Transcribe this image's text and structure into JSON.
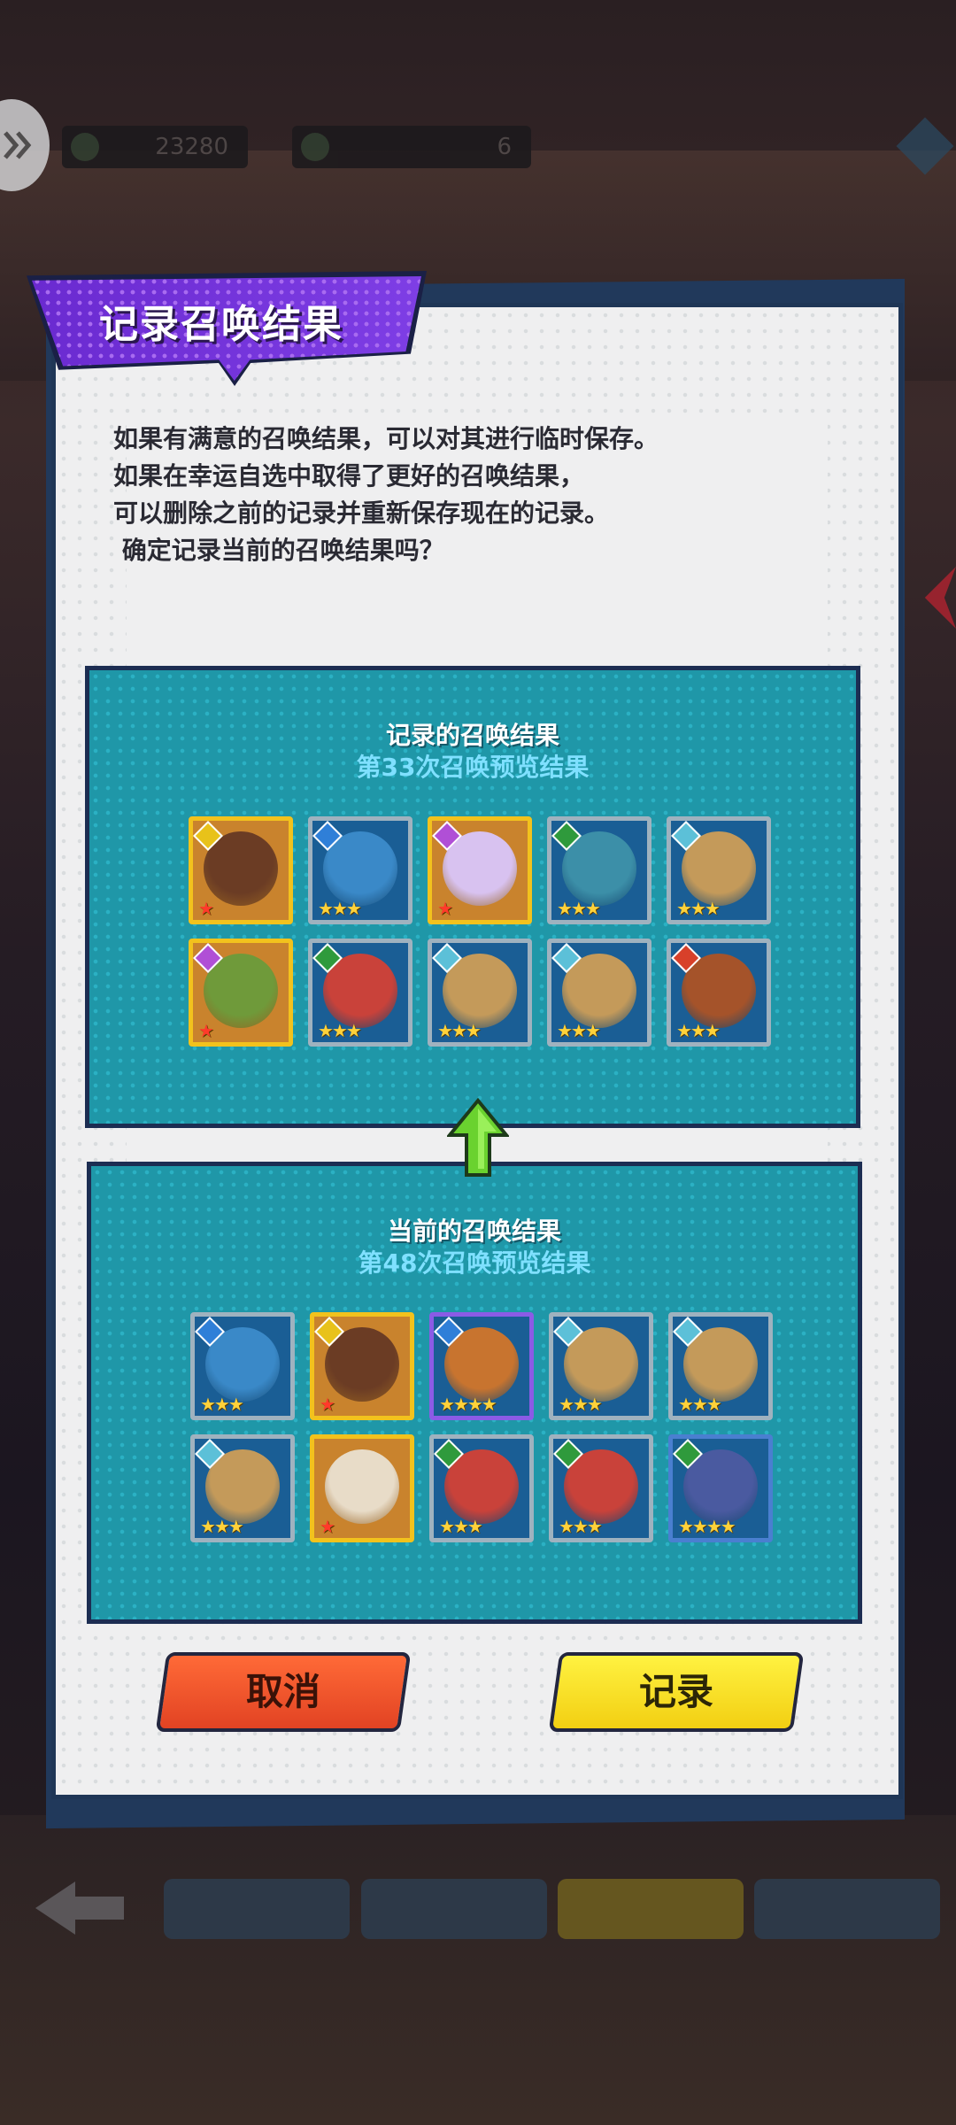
{
  "hud": {
    "currency_1": "23280",
    "currency_2": "6"
  },
  "dialog": {
    "title": "记录召唤结果",
    "description": [
      "如果有满意的召唤结果，可以对其进行临时保存。",
      "如果在幸运自选中取得了更好的召唤结果，",
      "可以删除之前的记录并重新保存现在的记录。",
      " 确定记录当前的召唤结果吗？"
    ],
    "saved_panel": {
      "title": "记录的召唤结果",
      "subtitle": "第33次召唤预览结果",
      "heroes": [
        {
          "frame": "gold",
          "element": "light-icon",
          "element_color": "#e8c21a",
          "stars": "★",
          "star_color": "red",
          "portrait_color": "#6b3c24"
        },
        {
          "frame": "silver",
          "element": "water-icon",
          "element_color": "#2f7fd8",
          "stars": "★★★",
          "star_color": "gold",
          "portrait_color": "#3a89c8"
        },
        {
          "frame": "gold",
          "element": "dark-icon",
          "element_color": "#b04fd6",
          "stars": "★",
          "star_color": "red",
          "portrait_color": "#d8c2f0"
        },
        {
          "frame": "silver",
          "element": "nature-icon",
          "element_color": "#2f9a3c",
          "stars": "★★★",
          "star_color": "gold",
          "portrait_color": "#3c8fa8"
        },
        {
          "frame": "silver",
          "element": "ice-icon",
          "element_color": "#5cc0d8",
          "stars": "★★★",
          "star_color": "gold",
          "portrait_color": "#c49a5a"
        },
        {
          "frame": "gold",
          "element": "dark-icon",
          "element_color": "#b04fd6",
          "stars": "★",
          "star_color": "red",
          "portrait_color": "#6f9a3a"
        },
        {
          "frame": "silver",
          "element": "nature-icon",
          "element_color": "#2f9a3c",
          "stars": "★★★",
          "star_color": "gold",
          "portrait_color": "#c9423a"
        },
        {
          "frame": "silver",
          "element": "ice-icon",
          "element_color": "#5cc0d8",
          "stars": "★★★",
          "star_color": "gold",
          "portrait_color": "#c49a5a"
        },
        {
          "frame": "silver",
          "element": "ice-icon",
          "element_color": "#5cc0d8",
          "stars": "★★★",
          "star_color": "gold",
          "portrait_color": "#c49a5a"
        },
        {
          "frame": "silver",
          "element": "fire-icon",
          "element_color": "#d8402a",
          "stars": "★★★",
          "star_color": "gold",
          "portrait_color": "#a5532a"
        }
      ]
    },
    "current_panel": {
      "title": "当前的召唤结果",
      "subtitle": "第48次召唤预览结果",
      "heroes": [
        {
          "frame": "silver",
          "element": "water-icon",
          "element_color": "#2f7fd8",
          "stars": "★★★",
          "star_color": "gold",
          "portrait_color": "#3a89c8"
        },
        {
          "frame": "gold",
          "element": "light-icon",
          "element_color": "#e8c21a",
          "stars": "★",
          "star_color": "red",
          "portrait_color": "#6b3c24"
        },
        {
          "frame": "purple",
          "element": "water-icon",
          "element_color": "#2f7fd8",
          "stars": "★★★★",
          "star_color": "gold",
          "portrait_color": "#c8742f"
        },
        {
          "frame": "silver",
          "element": "ice-icon",
          "element_color": "#5cc0d8",
          "stars": "★★★",
          "star_color": "gold",
          "portrait_color": "#c49a5a"
        },
        {
          "frame": "silver",
          "element": "ice-icon",
          "element_color": "#5cc0d8",
          "stars": "★★★",
          "star_color": "gold",
          "portrait_color": "#c49a5a"
        },
        {
          "frame": "silver",
          "element": "ice-icon",
          "element_color": "#5cc0d8",
          "stars": "★★★",
          "star_color": "gold",
          "portrait_color": "#c49a5a"
        },
        {
          "frame": "gold",
          "element": "none",
          "element_color": "",
          "stars": "★",
          "star_color": "red",
          "portrait_color": "#e8dcc8"
        },
        {
          "frame": "silver",
          "element": "nature-icon",
          "element_color": "#2f9a3c",
          "stars": "★★★",
          "star_color": "gold",
          "portrait_color": "#c9423a"
        },
        {
          "frame": "silver",
          "element": "nature-icon",
          "element_color": "#2f9a3c",
          "stars": "★★★",
          "star_color": "gold",
          "portrait_color": "#c9423a"
        },
        {
          "frame": "blue",
          "element": "nature-icon",
          "element_color": "#2f9a3c",
          "stars": "★★★★",
          "star_color": "gold",
          "portrait_color": "#4a5aa0"
        }
      ]
    },
    "cancel_label": "取消",
    "record_label": "记录"
  }
}
